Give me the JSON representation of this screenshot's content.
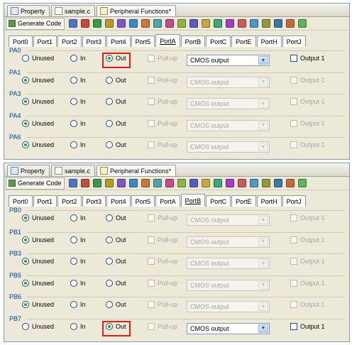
{
  "doc_tabs": [
    {
      "label": "Property",
      "icon": "property-icon"
    },
    {
      "label": "sample.c",
      "icon": "file-icon"
    },
    {
      "label": "Peripheral Functions*",
      "icon": "peripheral-functions-icon"
    }
  ],
  "toolbar": {
    "generate_label": "Generate Code",
    "icons": [
      "#4a78c8",
      "#c84a3a",
      "#3a9a4a",
      "#b89a2a",
      "#7a5ac8",
      "#3a8ac8",
      "#c8783a",
      "#4aa8a8",
      "#c84a8a",
      "#8ab83a",
      "#5a5ac8",
      "#c8a83a",
      "#3aa878",
      "#a83ac8",
      "#c85a5a",
      "#4a9ac8",
      "#98983a",
      "#3a78a8",
      "#c8683a",
      "#5ab85a"
    ]
  },
  "port_tabs": [
    "Port0",
    "Port1",
    "Port2",
    "Port3",
    "Port4",
    "Port5",
    "PortA",
    "PortB",
    "PortC",
    "PortE",
    "PortH",
    "PortJ"
  ],
  "options": {
    "unused": "Unused",
    "in": "In",
    "out": "Out",
    "pullup": "Pull-up",
    "output_type": "CMOS output",
    "output1": "Output 1"
  },
  "panel_top": {
    "active_port": "PortA",
    "pins": [
      {
        "name": "PA0",
        "selected": "Out"
      },
      {
        "name": "PA1",
        "selected": "Unused"
      },
      {
        "name": "PA3",
        "selected": "Unused"
      },
      {
        "name": "PA4",
        "selected": "Unused"
      },
      {
        "name": "PA6",
        "selected": "Unused"
      }
    ]
  },
  "panel_bottom": {
    "active_port": "PortB",
    "pins": [
      {
        "name": "PB0",
        "selected": "Unused"
      },
      {
        "name": "PB1",
        "selected": "Unused"
      },
      {
        "name": "PB3",
        "selected": "Unused"
      },
      {
        "name": "PB5",
        "selected": "Unused"
      },
      {
        "name": "PB6",
        "selected": "Unused"
      },
      {
        "name": "PB7",
        "selected": "Out"
      }
    ]
  },
  "colors": {
    "highlight": "#e51a1a",
    "selected_dot": "#21a121",
    "group_label": "#0040a0",
    "panel_bg": "#ece9d8"
  }
}
